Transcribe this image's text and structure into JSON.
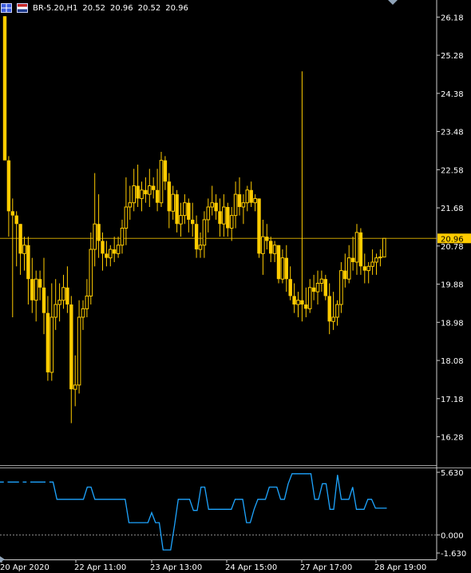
{
  "header": {
    "symbol": "BR-5.20,H1",
    "ohlc": [
      "20.52",
      "20.96",
      "20.52",
      "20.96"
    ]
  },
  "colors": {
    "background": "#000000",
    "candle": "#ffcc00",
    "price_line": "#c8a000",
    "price_badge": "#ffcc00",
    "axis_text": "#ffffff",
    "indicator": "#1ea5ff",
    "divider": "#9a9a9a"
  },
  "chart_data": [
    {
      "type": "candlestick",
      "title": "BR-5.20,H1",
      "y_ticks": [
        "26.18",
        "25.28",
        "24.38",
        "23.48",
        "22.58",
        "21.68",
        "20.78",
        "19.88",
        "18.98",
        "18.08",
        "17.18",
        "16.28"
      ],
      "ylim": [
        15.8,
        26.3
      ],
      "x_ticks": [
        "20 Apr 2020",
        "22 Apr 11:00",
        "23 Apr 13:00",
        "24 Apr 15:00",
        "27 Apr 17:00",
        "28 Apr 19:00"
      ],
      "current_price": "20.96",
      "ohlc": [
        [
          26.2,
          26.2,
          22.8,
          22.8
        ],
        [
          22.8,
          22.9,
          21.0,
          21.6
        ],
        [
          21.6,
          21.9,
          19.1,
          21.5
        ],
        [
          21.5,
          21.6,
          20.3,
          21.3
        ],
        [
          21.3,
          21.3,
          20.1,
          20.6
        ],
        [
          20.6,
          21.0,
          20.2,
          20.8
        ],
        [
          20.8,
          21.0,
          19.4,
          20.0
        ],
        [
          20.0,
          20.5,
          19.2,
          19.5
        ],
        [
          19.5,
          20.2,
          19.0,
          20.0
        ],
        [
          20.0,
          20.2,
          19.5,
          19.8
        ],
        [
          19.8,
          20.5,
          18.7,
          19.2
        ],
        [
          19.2,
          19.6,
          17.6,
          17.8
        ],
        [
          17.8,
          19.9,
          17.6,
          19.1
        ],
        [
          19.1,
          20.0,
          18.8,
          19.4
        ],
        [
          19.4,
          19.9,
          19.0,
          19.5
        ],
        [
          19.5,
          20.1,
          19.3,
          19.8
        ],
        [
          19.8,
          20.3,
          19.2,
          19.4
        ],
        [
          19.4,
          19.6,
          16.6,
          17.4
        ],
        [
          17.4,
          18.2,
          17.0,
          17.5
        ],
        [
          17.5,
          19.5,
          17.3,
          19.1
        ],
        [
          19.1,
          19.5,
          18.8,
          19.3
        ],
        [
          19.3,
          20.0,
          19.1,
          19.6
        ],
        [
          19.6,
          21.1,
          19.4,
          20.7
        ],
        [
          20.7,
          22.5,
          20.3,
          21.3
        ],
        [
          21.3,
          22.0,
          20.5,
          20.9
        ],
        [
          20.9,
          21.1,
          20.2,
          20.6
        ],
        [
          20.6,
          20.9,
          20.3,
          20.5
        ],
        [
          20.5,
          20.8,
          20.3,
          20.7
        ],
        [
          20.7,
          21.0,
          20.4,
          20.6
        ],
        [
          20.6,
          21.0,
          20.5,
          20.8
        ],
        [
          20.8,
          21.4,
          20.6,
          21.2
        ],
        [
          21.2,
          22.4,
          20.8,
          21.7
        ],
        [
          21.7,
          22.2,
          21.4,
          21.8
        ],
        [
          21.8,
          22.6,
          21.6,
          22.2
        ],
        [
          22.2,
          22.7,
          21.7,
          21.9
        ],
        [
          21.9,
          22.3,
          21.6,
          22.1
        ],
        [
          22.1,
          22.4,
          21.8,
          22.0
        ],
        [
          22.0,
          22.6,
          21.7,
          22.2
        ],
        [
          22.2,
          22.4,
          21.9,
          22.1
        ],
        [
          22.1,
          22.6,
          21.6,
          21.8
        ],
        [
          21.8,
          23.0,
          21.7,
          22.8
        ],
        [
          22.8,
          22.9,
          22.1,
          22.3
        ],
        [
          22.3,
          22.5,
          21.2,
          21.6
        ],
        [
          21.6,
          22.2,
          21.4,
          22.0
        ],
        [
          22.0,
          22.1,
          21.1,
          21.3
        ],
        [
          21.3,
          21.8,
          21.0,
          21.5
        ],
        [
          21.5,
          22.0,
          21.3,
          21.8
        ],
        [
          21.8,
          21.9,
          21.1,
          21.4
        ],
        [
          21.4,
          21.8,
          21.0,
          21.3
        ],
        [
          21.3,
          21.5,
          20.5,
          20.7
        ],
        [
          20.7,
          21.1,
          20.5,
          20.8
        ],
        [
          20.8,
          21.6,
          20.5,
          21.4
        ],
        [
          21.4,
          21.9,
          21.1,
          21.7
        ],
        [
          21.7,
          22.2,
          21.5,
          21.8
        ],
        [
          21.8,
          22.0,
          21.4,
          21.6
        ],
        [
          21.6,
          21.9,
          21.0,
          21.3
        ],
        [
          21.3,
          22.0,
          21.0,
          21.7
        ],
        [
          21.7,
          21.8,
          21.0,
          21.2
        ],
        [
          21.2,
          21.7,
          20.9,
          21.5
        ],
        [
          21.5,
          22.3,
          21.2,
          22.0
        ],
        [
          22.0,
          22.4,
          21.5,
          21.7
        ],
        [
          21.7,
          22.0,
          21.3,
          21.8
        ],
        [
          21.8,
          22.2,
          21.6,
          22.1
        ],
        [
          22.1,
          22.3,
          21.7,
          21.8
        ],
        [
          21.8,
          22.0,
          21.6,
          21.9
        ],
        [
          21.9,
          21.9,
          20.5,
          20.6
        ],
        [
          20.6,
          21.4,
          20.1,
          21.0
        ],
        [
          21.0,
          21.3,
          20.7,
          20.9
        ],
        [
          20.9,
          21.0,
          20.4,
          20.6
        ],
        [
          20.6,
          20.9,
          20.4,
          20.8
        ],
        [
          20.8,
          20.8,
          19.9,
          20.0
        ],
        [
          20.0,
          20.7,
          19.9,
          20.5
        ],
        [
          20.5,
          20.8,
          19.7,
          20.0
        ],
        [
          20.0,
          20.3,
          19.5,
          19.6
        ],
        [
          19.6,
          19.9,
          19.2,
          19.4
        ],
        [
          19.4,
          19.7,
          19.1,
          19.5
        ],
        [
          19.5,
          24.9,
          19.0,
          19.4
        ],
        [
          19.4,
          19.8,
          19.1,
          19.3
        ],
        [
          19.3,
          20.0,
          19.2,
          19.8
        ],
        [
          19.8,
          20.1,
          19.5,
          19.7
        ],
        [
          19.7,
          20.2,
          19.4,
          19.9
        ],
        [
          19.9,
          20.2,
          19.7,
          20.0
        ],
        [
          20.0,
          20.1,
          19.5,
          19.6
        ],
        [
          19.6,
          19.9,
          18.7,
          19.0
        ],
        [
          19.0,
          19.7,
          18.8,
          19.1
        ],
        [
          19.1,
          19.5,
          18.9,
          19.4
        ],
        [
          19.4,
          20.4,
          19.2,
          20.2
        ],
        [
          20.2,
          20.6,
          19.8,
          20.0
        ],
        [
          20.0,
          20.8,
          19.9,
          20.5
        ],
        [
          20.5,
          21.0,
          20.2,
          20.4
        ],
        [
          20.4,
          21.3,
          20.1,
          21.1
        ],
        [
          21.1,
          21.2,
          20.1,
          20.3
        ],
        [
          20.3,
          20.6,
          19.9,
          20.2
        ],
        [
          20.2,
          20.4,
          19.9,
          20.3
        ],
        [
          20.3,
          20.7,
          20.1,
          20.4
        ],
        [
          20.4,
          20.6,
          20.1,
          20.5
        ],
        [
          20.5,
          20.7,
          20.3,
          20.52
        ],
        [
          20.52,
          20.96,
          20.52,
          20.96
        ]
      ]
    },
    {
      "type": "line",
      "y_ticks": [
        "5.630",
        "0.000",
        "-1.630"
      ],
      "ylim": [
        -1.63,
        5.63
      ],
      "series": [
        {
          "values": [
            4.75,
            4.75,
            4.75,
            4.75,
            4.75,
            4.75,
            4.75,
            4.75,
            4.75,
            4.75,
            4.75,
            4.75,
            4.75,
            4.75,
            4.75,
            3.2,
            3.2,
            3.2,
            3.2,
            3.2,
            3.2,
            3.2,
            3.2,
            4.3,
            4.3,
            3.2,
            3.2,
            3.2,
            3.2,
            3.2,
            3.2,
            3.2,
            3.2,
            3.2,
            1.1,
            1.1,
            1.1,
            1.1,
            1.1,
            1.1,
            2.0,
            1.1,
            1.1,
            -1.35,
            -1.35,
            -1.35,
            0.8,
            3.2,
            3.2,
            3.2,
            3.2,
            2.2,
            2.2,
            4.3,
            4.3,
            2.3,
            2.3,
            2.3,
            2.3,
            2.3,
            2.3,
            2.3,
            3.2,
            3.2,
            3.2,
            1.1,
            1.1,
            2.3,
            3.2,
            3.2,
            3.2,
            4.3,
            4.3,
            4.3,
            3.2,
            3.2,
            4.6,
            5.5,
            5.5,
            5.5,
            5.5,
            5.5,
            5.5,
            3.2,
            3.2,
            4.6,
            4.6,
            2.3,
            2.3,
            5.4,
            3.2,
            3.2,
            3.2,
            4.3,
            2.3,
            2.3,
            2.3,
            3.2,
            3.2,
            2.4,
            2.4,
            2.4,
            2.4
          ]
        }
      ]
    }
  ]
}
